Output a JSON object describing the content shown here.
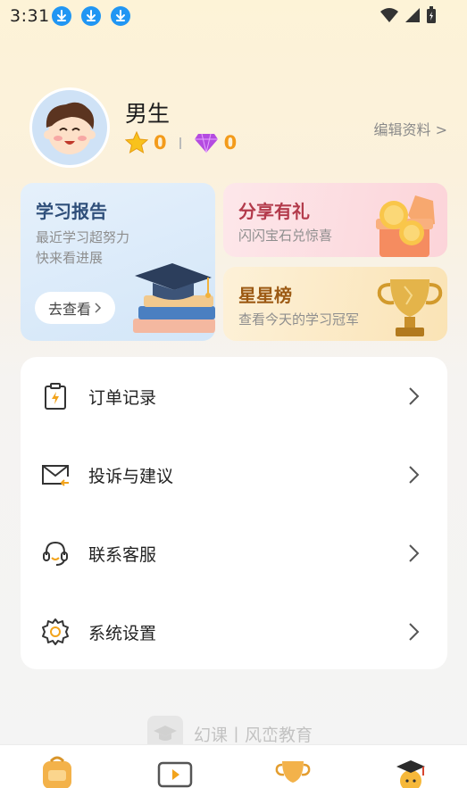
{
  "status_bar": {
    "time": "3:31"
  },
  "profile": {
    "name": "男生",
    "stars": "0",
    "gems": "0",
    "edit_label": "编辑资料 >"
  },
  "cards": {
    "report": {
      "title": "学习报告",
      "subtitle_line1": "最近学习超努力",
      "subtitle_line2": "快来看进展",
      "button_label": "去查看"
    },
    "share": {
      "title": "分享有礼",
      "subtitle": "闪闪宝石兑惊喜"
    },
    "rank": {
      "title": "星星榜",
      "subtitle": "查看今天的学习冠军"
    }
  },
  "menu": {
    "items": [
      {
        "label": "订单记录",
        "icon": "order-clipboard-icon"
      },
      {
        "label": "投诉与建议",
        "icon": "mail-feedback-icon"
      },
      {
        "label": "联系客服",
        "icon": "headset-icon"
      },
      {
        "label": "系统设置",
        "icon": "gear-icon"
      }
    ]
  },
  "brand": {
    "text": "幻课丨风峦教育"
  },
  "colors": {
    "accent_orange": "#f39b1b",
    "download_blue": "#2196f3"
  }
}
